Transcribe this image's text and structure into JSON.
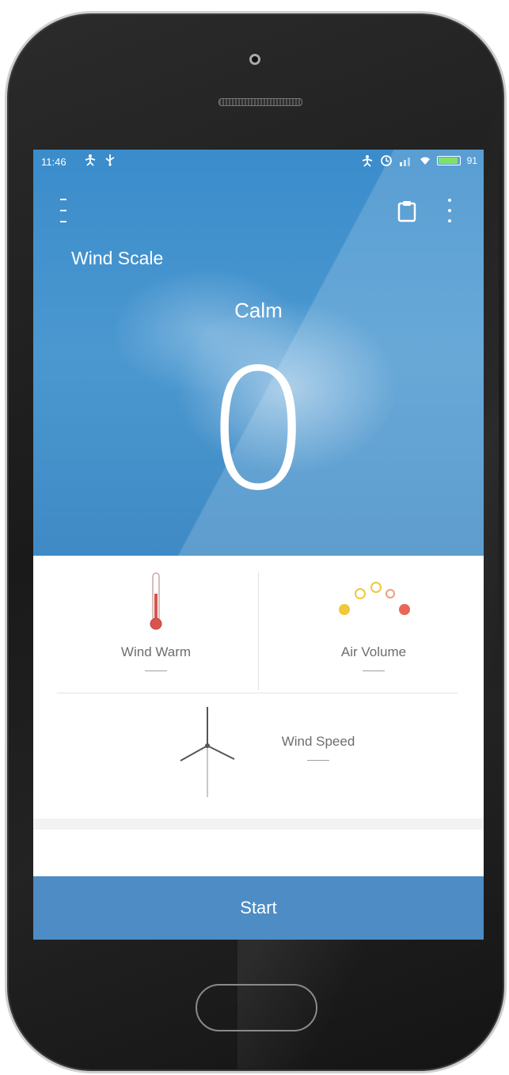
{
  "status_bar": {
    "time": "11:46",
    "left_icons": [
      "person-icon",
      "usb-icon"
    ],
    "right_icons": [
      "person-icon",
      "alarm-icon",
      "signal-icon",
      "wifi-icon",
      "battery-icon"
    ],
    "battery_percent": "91"
  },
  "header": {
    "menu_icon": "menu-icon",
    "clipboard_icon": "clipboard-icon",
    "more_icon": "more-vertical-icon"
  },
  "hero": {
    "title": "Wind Scale",
    "condition": "Calm",
    "value": "0"
  },
  "metrics": {
    "wind_warm": {
      "label": "Wind Warm",
      "value": "——",
      "icon": "thermometer-icon"
    },
    "air_volume": {
      "label": "Air Volume",
      "value": "——",
      "icon": "air-volume-icon"
    },
    "wind_speed": {
      "label": "Wind Speed",
      "value": "——",
      "icon": "wind-turbine-icon"
    }
  },
  "actions": {
    "start_label": "Start"
  },
  "colors": {
    "hero_blue": "#4b98d0",
    "start_blue": "#4d8cc5",
    "thermometer_red": "#d9534f",
    "dot_yellow": "#f0c93a",
    "dot_red": "#e9665a"
  }
}
